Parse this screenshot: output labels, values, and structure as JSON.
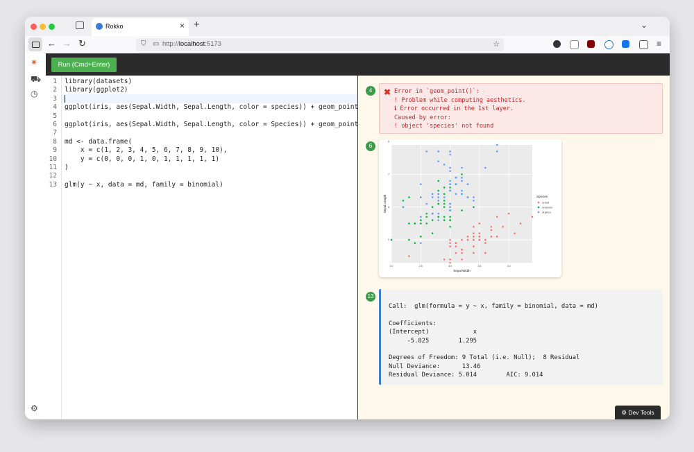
{
  "browser": {
    "tab_title": "Rokko",
    "tab_close": "×",
    "new_tab": "+",
    "tab_list": "⌄",
    "url_scheme_host": "http://",
    "url_host": "localhost",
    "url_port": ":5173",
    "back": "←",
    "forward": "→",
    "reload": "↻",
    "menu": "≡"
  },
  "toolbar": {
    "run_label": "Run (Cmd+Enter)"
  },
  "editor": {
    "line_numbers": [
      "1",
      "2",
      "3",
      "4",
      "5",
      "6",
      "7",
      "8",
      "9",
      "10",
      "11",
      "12",
      "13"
    ],
    "lines": [
      "library(datasets)",
      "library(ggplot2)",
      "",
      "ggplot(iris, aes(Sepal.Width, Sepal.Length, color = species)) + geom_point()",
      "",
      "ggplot(iris, aes(Sepal.Width, Sepal.Length, color = Species)) + geom_point()",
      "",
      "md <- data.frame(",
      "    x = c(1, 2, 3, 4, 5, 6, 7, 8, 9, 10),",
      "    y = c(0, 0, 0, 1, 0, 1, 1, 1, 1, 1)",
      ")",
      "",
      "glm(y ~ x, data = md, family = binomial)"
    ]
  },
  "output": {
    "error": {
      "badge": "4",
      "lines": [
        "Error in `geom_point()`:",
        "! Problem while computing aesthetics.",
        "ℹ Error occurred in the 1st layer.",
        "Caused by error:",
        "! object 'species' not found"
      ]
    },
    "plot": {
      "badge": "6",
      "xlabel": "Sepal.Width",
      "ylabel": "Sepal.Length",
      "x_ticks": [
        "2.0",
        "2.5",
        "3.0",
        "3.5",
        "4.0",
        "4.5"
      ],
      "y_ticks": [
        "5",
        "6",
        "7",
        "8"
      ],
      "legend_title": "Species",
      "legend_items": [
        "setosa",
        "versicolor",
        "virginica"
      ],
      "colors": {
        "setosa": "#f8766d",
        "versicolor": "#00ba38",
        "virginica": "#619cff"
      }
    },
    "glm": {
      "badge": "13",
      "lines": [
        "Call:  glm(formula = y ~ x, family = binomial, data = md)",
        "",
        "Coefficients:",
        "(Intercept)            x",
        "     -5.825        1.295",
        "",
        "Degrees of Freedom: 9 Total (i.e. Null);  8 Residual",
        "Null Deviance:      13.46",
        "Residual Deviance: 5.014        AIC: 9.014"
      ]
    }
  },
  "devtools": {
    "label": "⚙ Dev Tools"
  },
  "chart_data": {
    "type": "scatter",
    "xlabel": "Sepal.Width",
    "ylabel": "Sepal.Length",
    "xlim": [
      2.0,
      4.4
    ],
    "ylim": [
      4.3,
      7.9
    ],
    "legend": "right",
    "series": [
      {
        "name": "setosa",
        "points": [
          [
            3.5,
            5.1
          ],
          [
            3.0,
            4.9
          ],
          [
            3.2,
            4.7
          ],
          [
            3.1,
            4.6
          ],
          [
            3.6,
            5.0
          ],
          [
            3.9,
            5.4
          ],
          [
            3.4,
            4.6
          ],
          [
            3.4,
            5.0
          ],
          [
            2.9,
            4.4
          ],
          [
            3.1,
            4.9
          ],
          [
            3.7,
            5.4
          ],
          [
            3.4,
            4.8
          ],
          [
            3.0,
            4.8
          ],
          [
            3.0,
            4.3
          ],
          [
            4.0,
            5.8
          ],
          [
            4.4,
            5.7
          ],
          [
            3.9,
            5.4
          ],
          [
            3.5,
            5.1
          ],
          [
            3.8,
            5.7
          ],
          [
            3.8,
            5.1
          ],
          [
            3.4,
            5.4
          ],
          [
            3.7,
            5.1
          ],
          [
            3.6,
            4.6
          ],
          [
            3.3,
            5.1
          ],
          [
            3.4,
            4.8
          ],
          [
            3.0,
            5.0
          ],
          [
            3.4,
            5.0
          ],
          [
            3.5,
            5.2
          ],
          [
            3.4,
            5.2
          ],
          [
            3.2,
            4.7
          ],
          [
            3.1,
            4.8
          ],
          [
            3.4,
            5.4
          ],
          [
            4.1,
            5.2
          ],
          [
            4.2,
            5.5
          ],
          [
            3.1,
            4.9
          ],
          [
            3.2,
            5.0
          ],
          [
            3.5,
            5.5
          ],
          [
            3.6,
            4.9
          ],
          [
            3.0,
            4.4
          ],
          [
            3.4,
            5.1
          ],
          [
            3.5,
            5.0
          ],
          [
            2.3,
            4.5
          ],
          [
            3.2,
            4.4
          ],
          [
            3.5,
            5.0
          ],
          [
            3.8,
            5.1
          ],
          [
            3.0,
            4.8
          ],
          [
            3.8,
            5.1
          ],
          [
            3.2,
            4.6
          ],
          [
            3.7,
            5.3
          ],
          [
            3.3,
            5.0
          ]
        ]
      },
      {
        "name": "versicolor",
        "points": [
          [
            3.2,
            7.0
          ],
          [
            3.2,
            6.4
          ],
          [
            3.1,
            6.9
          ],
          [
            2.3,
            5.5
          ],
          [
            2.8,
            6.5
          ],
          [
            2.8,
            5.7
          ],
          [
            3.3,
            6.3
          ],
          [
            2.4,
            4.9
          ],
          [
            2.9,
            6.6
          ],
          [
            2.7,
            5.2
          ],
          [
            2.0,
            5.0
          ],
          [
            3.0,
            5.9
          ],
          [
            2.2,
            6.0
          ],
          [
            2.9,
            6.1
          ],
          [
            2.9,
            5.6
          ],
          [
            3.1,
            6.7
          ],
          [
            3.0,
            5.6
          ],
          [
            2.7,
            5.8
          ],
          [
            2.2,
            6.2
          ],
          [
            2.5,
            5.6
          ],
          [
            3.2,
            5.9
          ],
          [
            2.8,
            6.1
          ],
          [
            2.5,
            6.3
          ],
          [
            2.8,
            6.1
          ],
          [
            2.9,
            6.4
          ],
          [
            3.0,
            6.6
          ],
          [
            2.8,
            6.8
          ],
          [
            3.0,
            6.7
          ],
          [
            2.9,
            6.0
          ],
          [
            2.6,
            5.7
          ],
          [
            2.4,
            5.5
          ],
          [
            2.4,
            5.5
          ],
          [
            2.7,
            5.8
          ],
          [
            2.7,
            6.0
          ],
          [
            3.0,
            5.4
          ],
          [
            3.4,
            6.0
          ],
          [
            3.1,
            6.7
          ],
          [
            2.3,
            6.3
          ],
          [
            3.0,
            5.6
          ],
          [
            2.5,
            5.5
          ],
          [
            2.6,
            5.5
          ],
          [
            3.0,
            6.1
          ],
          [
            2.6,
            5.8
          ],
          [
            2.3,
            5.0
          ],
          [
            2.7,
            5.6
          ],
          [
            3.0,
            5.7
          ],
          [
            2.9,
            5.7
          ],
          [
            2.9,
            6.2
          ],
          [
            2.5,
            5.1
          ],
          [
            2.8,
            5.7
          ]
        ]
      },
      {
        "name": "virginica",
        "points": [
          [
            3.3,
            6.3
          ],
          [
            2.7,
            5.8
          ],
          [
            3.0,
            7.1
          ],
          [
            2.9,
            6.3
          ],
          [
            3.0,
            6.5
          ],
          [
            3.0,
            7.6
          ],
          [
            2.5,
            4.9
          ],
          [
            2.9,
            7.3
          ],
          [
            2.5,
            6.7
          ],
          [
            3.6,
            7.2
          ],
          [
            3.2,
            6.5
          ],
          [
            2.7,
            6.4
          ],
          [
            3.0,
            6.8
          ],
          [
            2.5,
            5.7
          ],
          [
            2.8,
            5.8
          ],
          [
            3.2,
            6.4
          ],
          [
            3.0,
            6.5
          ],
          [
            3.8,
            7.7
          ],
          [
            2.6,
            7.7
          ],
          [
            2.2,
            6.0
          ],
          [
            3.2,
            6.9
          ],
          [
            2.8,
            5.6
          ],
          [
            2.8,
            7.7
          ],
          [
            2.7,
            6.3
          ],
          [
            3.3,
            6.7
          ],
          [
            3.2,
            7.2
          ],
          [
            2.8,
            6.2
          ],
          [
            3.0,
            6.1
          ],
          [
            2.8,
            6.4
          ],
          [
            3.0,
            7.2
          ],
          [
            2.8,
            7.4
          ],
          [
            3.8,
            7.9
          ],
          [
            2.8,
            6.4
          ],
          [
            2.8,
            6.3
          ],
          [
            2.6,
            6.1
          ],
          [
            3.0,
            7.7
          ],
          [
            3.4,
            6.3
          ],
          [
            3.1,
            6.4
          ],
          [
            3.0,
            6.0
          ],
          [
            3.1,
            6.9
          ],
          [
            3.1,
            6.7
          ],
          [
            3.1,
            6.9
          ],
          [
            2.7,
            5.8
          ],
          [
            3.2,
            6.8
          ],
          [
            3.3,
            6.7
          ],
          [
            3.0,
            6.7
          ],
          [
            2.5,
            6.3
          ],
          [
            3.0,
            6.5
          ],
          [
            3.4,
            6.2
          ],
          [
            3.0,
            5.9
          ]
        ]
      }
    ]
  }
}
